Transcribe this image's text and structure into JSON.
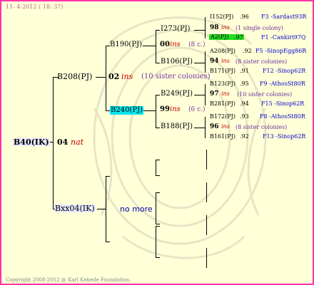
{
  "header": {
    "date_line": "11- 4-2012 ( 18: 37)"
  },
  "footer": {
    "copyright": "Copyright 2008-2012 @ Karl Kehede Foundation."
  },
  "root": {
    "label": "B40(IK)",
    "gen": "04",
    "tag": "nat"
  },
  "father": {
    "label": "B208(PJ)",
    "gen": "02",
    "tag": "ins",
    "note": "(10 sister colonies)"
  },
  "mother": {
    "label": "Bxx04(IK)",
    "note": "no more"
  },
  "ff": {
    "label": "B190(PJ)"
  },
  "fm": {
    "label": "B240(PJ)",
    "highlight": "#00e5ee"
  },
  "ff_sire": {
    "label": "I273(PJ)",
    "gen": "00",
    "tag": "ins",
    "note": "(8 c.)"
  },
  "ff_dam": {
    "label": "B106(PJ)"
  },
  "fm_sire": {
    "label": "B249(PJ)"
  },
  "fm_gen": {
    "gen": "99",
    "tag": "ins",
    "note": "(6 c.)"
  },
  "fm_dam": {
    "label": "B188(PJ)"
  },
  "leaves": [
    {
      "label": "I152(PJ)",
      "num": ".96",
      "right": "F3 -Sardast93R"
    },
    {
      "gen": "98",
      "tag": "ins",
      "note": "(1 single colony)"
    },
    {
      "label": "A2(PJ)",
      "num": ".97",
      "right": "F1 -Cankiri97Q",
      "highlight": "#22dd22"
    },
    {
      "label": "A208(PJ)",
      "num": ".92",
      "right": "F5 -SinopEgg86R"
    },
    {
      "gen": "94",
      "tag": "ins",
      "note": "(8 sister colonies)"
    },
    {
      "label": "B171(PJ)",
      "num": ".91",
      "right": "F12 -Sinop62R"
    },
    {
      "label": "B123(PJ)",
      "num": ".95",
      "right": "F9 -AthosSt80R"
    },
    {
      "gen": "97",
      "tag": "ins",
      "note": "(10 sister colonies)"
    },
    {
      "label": "B281(PJ)",
      "num": ".94",
      "right": "F15 -Sinop62R"
    },
    {
      "label": "B172(PJ)",
      "num": ".93",
      "right": "F8 -AthosSt80R"
    },
    {
      "gen": "96",
      "tag": "ins",
      "note": "(8 sister colonies)"
    },
    {
      "label": "B161(PJ)",
      "num": ".92",
      "right": "F13 -Sinop62R"
    }
  ],
  "colors": {
    "border": "#ff33aa",
    "background": "#ffffd8",
    "accent_blue": "#0000cc",
    "ins_red": "#cc0000"
  }
}
